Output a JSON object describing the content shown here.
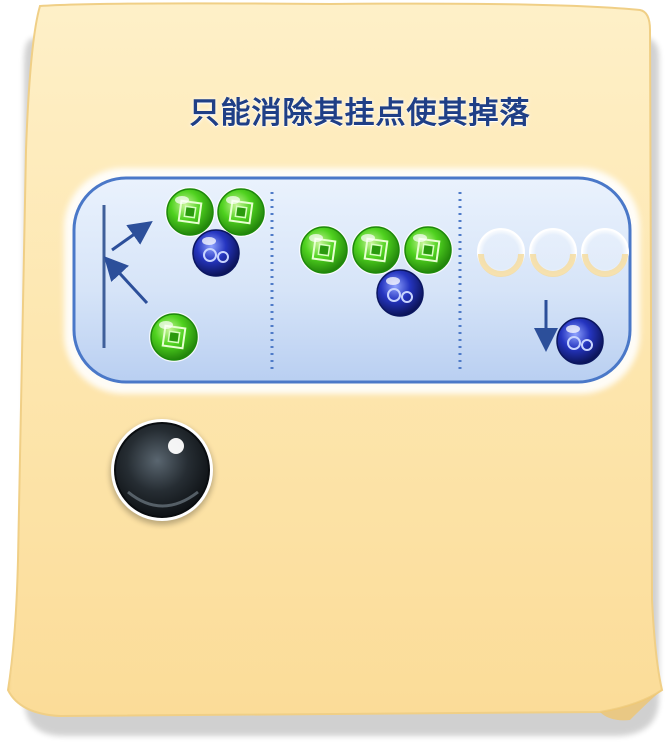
{
  "tip_card": {
    "title": "只能消除其挂点使其掉落",
    "panels": [
      {
        "name": "bounce-shot",
        "description_icons": [
          "bounce-arrow-icon",
          "bounce-arrow-icon"
        ],
        "balls": [
          "green-bubble",
          "green-bubble",
          "green-bubble",
          "blue-bubble"
        ]
      },
      {
        "name": "hanging-bubble",
        "balls": [
          "green-bubble",
          "green-bubble",
          "green-bubble",
          "blue-bubble"
        ]
      },
      {
        "name": "bubble-falls",
        "balls": [
          "empty-slot",
          "empty-slot",
          "empty-slot",
          "blue-bubble"
        ],
        "description_icons": [
          "down-arrow-icon"
        ]
      }
    ],
    "shooter_ball": "black-bubble"
  },
  "colors": {
    "card": "#fde8b4",
    "card_edge": "#f3d28a",
    "panel": "#cfe0f7",
    "panel_border": "#4a78c8",
    "title": "#1f3f86",
    "green_bubble": "#3fc21a",
    "blue_bubble": "#1a2da8",
    "black_bubble": "#1c2226"
  }
}
